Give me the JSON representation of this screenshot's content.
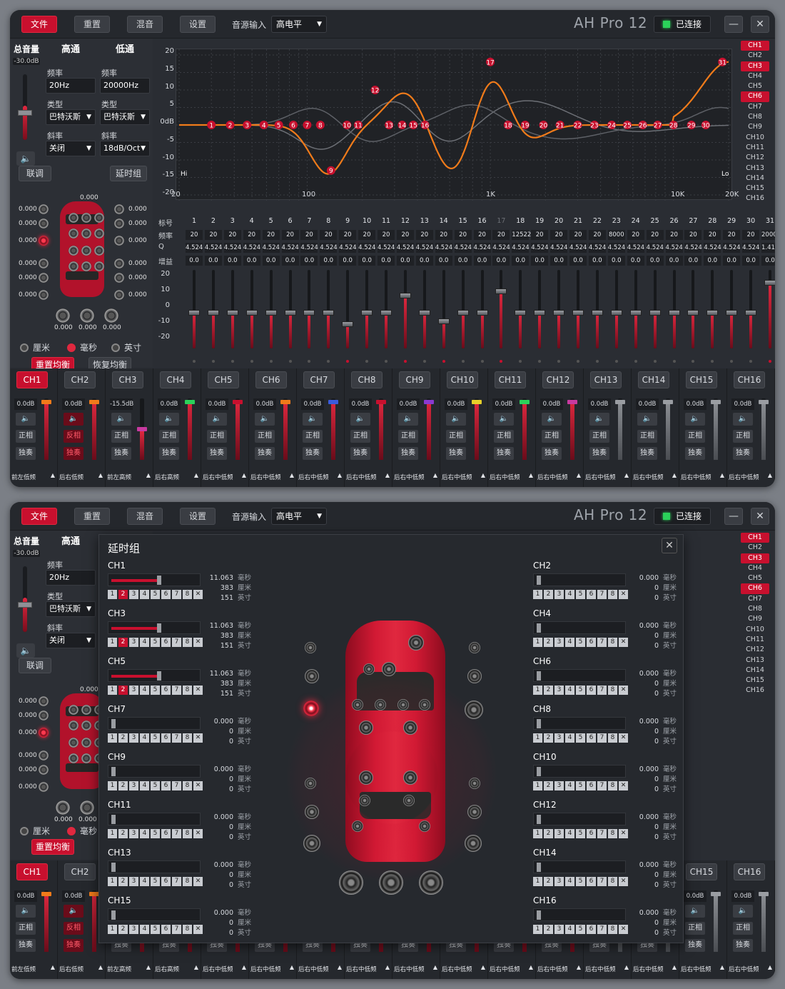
{
  "app": {
    "title": "AH Pro 12",
    "menu": [
      "文件",
      "重置",
      "混音",
      "设置"
    ],
    "source_label": "音源输入",
    "source_value": "高电平",
    "conn_label": "已连接",
    "minimize": "—",
    "close": "✕"
  },
  "left": {
    "vol_title": "总音量",
    "vol_value": "-30.0dB",
    "hp": {
      "title": "高通",
      "freq_label": "频率",
      "freq": "20Hz",
      "type_label": "类型",
      "type": "巴特沃斯",
      "slope_label": "斜率",
      "slope": "关闭"
    },
    "lp": {
      "title": "低通",
      "freq_label": "频率",
      "freq": "20000Hz",
      "type_label": "类型",
      "type": "巴特沃斯",
      "slope_label": "斜率",
      "slope": "18dB/Oct"
    },
    "link": "联调",
    "delay_group": "延时组",
    "zero": "0.000",
    "units": [
      "厘米",
      "毫秒",
      "英寸"
    ],
    "reset_eq": "重置均衡",
    "restore_eq": "恢复均衡"
  },
  "graph": {
    "y_ticks": [
      "20",
      "15",
      "10",
      "5",
      "0dB",
      "-5",
      "-10",
      "-15",
      "-20"
    ],
    "x_ticks": [
      "20",
      "100",
      "1K",
      "10K",
      "20K"
    ],
    "hi": "Hi",
    "lo": "Lo"
  },
  "channels": [
    "CH1",
    "CH2",
    "CH3",
    "CH4",
    "CH5",
    "CH6",
    "CH7",
    "CH8",
    "CH9",
    "CH10",
    "CH11",
    "CH12",
    "CH13",
    "CH14",
    "CH15",
    "CH16"
  ],
  "channels_on": [
    "CH1",
    "CH3",
    "CH6"
  ],
  "eq": {
    "row_labels": [
      "标号",
      "频率",
      "Q",
      "增益"
    ],
    "gain_ticks": [
      "20",
      "10",
      "0",
      "-10",
      "-20"
    ],
    "bands": [
      {
        "n": "1",
        "f": "20",
        "q": "4.524",
        "g": "0.0"
      },
      {
        "n": "2",
        "f": "20",
        "q": "4.524",
        "g": "0.0"
      },
      {
        "n": "3",
        "f": "20",
        "q": "4.524",
        "g": "0.0"
      },
      {
        "n": "4",
        "f": "20",
        "q": "4.524",
        "g": "0.0"
      },
      {
        "n": "5",
        "f": "20",
        "q": "4.524",
        "g": "0.0"
      },
      {
        "n": "6",
        "f": "20",
        "q": "4.524",
        "g": "0.0"
      },
      {
        "n": "7",
        "f": "20",
        "q": "4.524",
        "g": "0.0"
      },
      {
        "n": "8",
        "f": "20",
        "q": "4.524",
        "g": "0.0"
      },
      {
        "n": "9",
        "f": "20",
        "q": "4.524",
        "g": "0.0"
      },
      {
        "n": "10",
        "f": "20",
        "q": "4.524",
        "g": "0.0"
      },
      {
        "n": "11",
        "f": "20",
        "q": "4.524",
        "g": "0.0"
      },
      {
        "n": "12",
        "f": "20",
        "q": "4.524",
        "g": "0.0"
      },
      {
        "n": "13",
        "f": "20",
        "q": "4.524",
        "g": "0.0"
      },
      {
        "n": "14",
        "f": "20",
        "q": "4.524",
        "g": "0.0"
      },
      {
        "n": "15",
        "f": "20",
        "q": "4.524",
        "g": "0.0"
      },
      {
        "n": "16",
        "f": "20",
        "q": "4.524",
        "g": "0.0"
      },
      {
        "n": "17",
        "f": "20",
        "q": "4.524",
        "g": "0.0"
      },
      {
        "n": "18",
        "f": "12522",
        "q": "4.524",
        "g": "0.0"
      },
      {
        "n": "19",
        "f": "20",
        "q": "4.524",
        "g": "0.0"
      },
      {
        "n": "20",
        "f": "20",
        "q": "4.524",
        "g": "0.0"
      },
      {
        "n": "21",
        "f": "20",
        "q": "4.524",
        "g": "0.0"
      },
      {
        "n": "22",
        "f": "20",
        "q": "4.524",
        "g": "0.0"
      },
      {
        "n": "23",
        "f": "8000",
        "q": "4.524",
        "g": "0.0"
      },
      {
        "n": "24",
        "f": "20",
        "q": "4.524",
        "g": "0.0"
      },
      {
        "n": "25",
        "f": "20",
        "q": "4.524",
        "g": "0.0"
      },
      {
        "n": "26",
        "f": "20",
        "q": "4.524",
        "g": "0.0"
      },
      {
        "n": "27",
        "f": "20",
        "q": "4.524",
        "g": "0.0"
      },
      {
        "n": "28",
        "f": "20",
        "q": "4.524",
        "g": "0.0"
      },
      {
        "n": "29",
        "f": "20",
        "q": "4.524",
        "g": "0.0"
      },
      {
        "n": "30",
        "f": "20",
        "q": "4.524",
        "g": "0.0"
      },
      {
        "n": "31",
        "f": "20000",
        "q": "1.414",
        "g": "0.0"
      }
    ]
  },
  "strip": {
    "positive": "正相",
    "inverse": "反相",
    "solo": "独奏",
    "items": [
      {
        "ch": "CH1",
        "db": "0.0dB",
        "name": "前左低频",
        "inv": false,
        "solo_red": false,
        "red": true
      },
      {
        "ch": "CH2",
        "db": "0.0dB",
        "name": "后右低频",
        "inv": true,
        "solo_red": true,
        "red": true
      },
      {
        "ch": "CH3",
        "db": "-15.5dB",
        "name": "前左高频",
        "inv": false,
        "solo_red": false,
        "red": true
      },
      {
        "ch": "CH4",
        "db": "0.0dB",
        "name": "后右高频",
        "inv": false,
        "solo_red": false,
        "red": true
      },
      {
        "ch": "CH5",
        "db": "0.0dB",
        "name": "后右中低频",
        "inv": false,
        "solo_red": false,
        "red": true
      },
      {
        "ch": "CH6",
        "db": "0.0dB",
        "name": "后右中低频",
        "inv": false,
        "solo_red": false,
        "red": true
      },
      {
        "ch": "CH7",
        "db": "0.0dB",
        "name": "后右中低频",
        "inv": false,
        "solo_red": false,
        "red": true
      },
      {
        "ch": "CH8",
        "db": "0.0dB",
        "name": "后右中低频",
        "inv": false,
        "solo_red": false,
        "red": true
      },
      {
        "ch": "CH9",
        "db": "0.0dB",
        "name": "后右中低频",
        "inv": false,
        "solo_red": false,
        "red": true
      },
      {
        "ch": "CH10",
        "db": "0.0dB",
        "name": "后右中低频",
        "inv": false,
        "solo_red": false,
        "red": true
      },
      {
        "ch": "CH11",
        "db": "0.0dB",
        "name": "后右中低频",
        "inv": false,
        "solo_red": false,
        "red": true
      },
      {
        "ch": "CH12",
        "db": "0.0dB",
        "name": "后右中低频",
        "inv": false,
        "solo_red": false,
        "red": true
      },
      {
        "ch": "CH13",
        "db": "0.0dB",
        "name": "后右中低频",
        "inv": false,
        "solo_red": false,
        "red": false
      },
      {
        "ch": "CH14",
        "db": "0.0dB",
        "name": "后右中低频",
        "inv": false,
        "solo_red": false,
        "red": false
      },
      {
        "ch": "CH15",
        "db": "0.0dB",
        "name": "后右中低频",
        "inv": false,
        "solo_red": false,
        "red": false
      },
      {
        "ch": "CH16",
        "db": "0.0dB",
        "name": "后右中低频",
        "inv": false,
        "solo_red": false,
        "red": false
      }
    ]
  },
  "dialog": {
    "title": "延时组",
    "close": "✕",
    "units": [
      "毫秒",
      "厘米",
      "英寸"
    ],
    "nums": [
      "1",
      "2",
      "3",
      "4",
      "5",
      "6",
      "7",
      "8",
      "✕"
    ],
    "left": [
      {
        "ch": "CH1",
        "ms": "11.063",
        "cm": "383",
        "in": "151",
        "sel": true
      },
      {
        "ch": "CH3",
        "ms": "11.063",
        "cm": "383",
        "in": "151",
        "sel": true
      },
      {
        "ch": "CH5",
        "ms": "11.063",
        "cm": "383",
        "in": "151",
        "sel": true
      },
      {
        "ch": "CH7",
        "ms": "0.000",
        "cm": "0",
        "in": "0",
        "sel": false
      },
      {
        "ch": "CH9",
        "ms": "0.000",
        "cm": "0",
        "in": "0",
        "sel": false
      },
      {
        "ch": "CH11",
        "ms": "0.000",
        "cm": "0",
        "in": "0",
        "sel": false
      },
      {
        "ch": "CH13",
        "ms": "0.000",
        "cm": "0",
        "in": "0",
        "sel": false
      },
      {
        "ch": "CH15",
        "ms": "0.000",
        "cm": "0",
        "in": "0",
        "sel": false
      }
    ],
    "right": [
      {
        "ch": "CH2",
        "ms": "0.000",
        "cm": "0",
        "in": "0",
        "sel": false
      },
      {
        "ch": "CH4",
        "ms": "0.000",
        "cm": "0",
        "in": "0",
        "sel": false
      },
      {
        "ch": "CH6",
        "ms": "0.000",
        "cm": "0",
        "in": "0",
        "sel": false
      },
      {
        "ch": "CH8",
        "ms": "0.000",
        "cm": "0",
        "in": "0",
        "sel": false
      },
      {
        "ch": "CH10",
        "ms": "0.000",
        "cm": "0",
        "in": "0",
        "sel": false
      },
      {
        "ch": "CH12",
        "ms": "0.000",
        "cm": "0",
        "in": "0",
        "sel": false
      },
      {
        "ch": "CH14",
        "ms": "0.000",
        "cm": "0",
        "in": "0",
        "sel": false
      },
      {
        "ch": "CH16",
        "ms": "0.000",
        "cm": "0",
        "in": "0",
        "sel": false
      }
    ]
  }
}
